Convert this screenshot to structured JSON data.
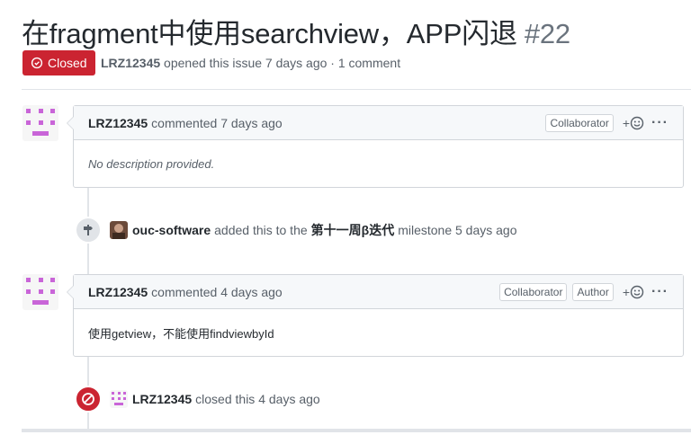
{
  "issue": {
    "title": "在fragment中使用searchview，APP闪退",
    "number": "#22",
    "state_label": "Closed",
    "author": "LRZ12345",
    "meta_text": "opened this issue 7 days ago · 1 comment"
  },
  "comments": [
    {
      "author": "LRZ12345",
      "time_text": "commented 7 days ago",
      "labels": [
        "Collaborator"
      ],
      "body": "No description provided."
    },
    {
      "author": "LRZ12345",
      "time_text": "commented 4 days ago",
      "labels": [
        "Collaborator",
        "Author"
      ],
      "body": "使用getview，不能使用findviewbyId"
    }
  ],
  "events": {
    "milestone": {
      "actor": "ouc-software",
      "prefix": "added this to the",
      "milestone": "第十一周β迭代",
      "suffix": "milestone 5 days ago"
    },
    "closed": {
      "actor": "LRZ12345",
      "text": "closed this 4 days ago"
    }
  },
  "icons": {
    "state": "issue-closed-icon",
    "react": "smiley-icon",
    "milestone": "milestone-icon",
    "closed": "circle-slash-icon",
    "more": "kebab-icon"
  },
  "colors": {
    "closed_red": "#cb2431",
    "identicon": "#c965d8",
    "muted": "#586069"
  },
  "ui": {
    "react_plus": "+",
    "more": "···"
  }
}
